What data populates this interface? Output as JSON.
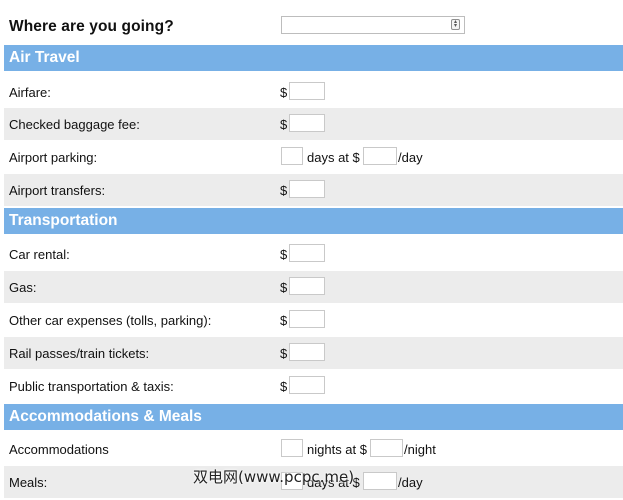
{
  "destination": {
    "label": "Where are you going?",
    "value": ""
  },
  "sections": {
    "air_travel": {
      "title": "Air Travel",
      "rows": {
        "airfare": {
          "label": "Airfare:",
          "currency": "$"
        },
        "baggage": {
          "label": "Checked baggage fee:",
          "currency": "$"
        },
        "parking": {
          "label": "Airport parking:",
          "days_text": "days at $",
          "unit": "/day"
        },
        "transfers": {
          "label": "Airport transfers:",
          "currency": "$"
        }
      }
    },
    "transportation": {
      "title": "Transportation",
      "rows": {
        "car_rental": {
          "label": "Car rental:",
          "currency": "$"
        },
        "gas": {
          "label": "Gas:",
          "currency": "$"
        },
        "other_car": {
          "label": "Other car expenses (tolls, parking):",
          "currency": "$"
        },
        "rail": {
          "label": "Rail passes/train tickets:",
          "currency": "$"
        },
        "public": {
          "label": "Public transportation & taxis:",
          "currency": "$"
        }
      }
    },
    "accommodations_meals": {
      "title": "Accommodations & Meals",
      "rows": {
        "accommodations": {
          "label": "Accommodations",
          "nights_text": "nights at $",
          "unit": "/night"
        },
        "meals": {
          "label": "Meals:",
          "days_text": "days at $",
          "unit": "/day"
        }
      }
    }
  },
  "watermark": {
    "text": "双电网(www.pcpc.me)"
  }
}
